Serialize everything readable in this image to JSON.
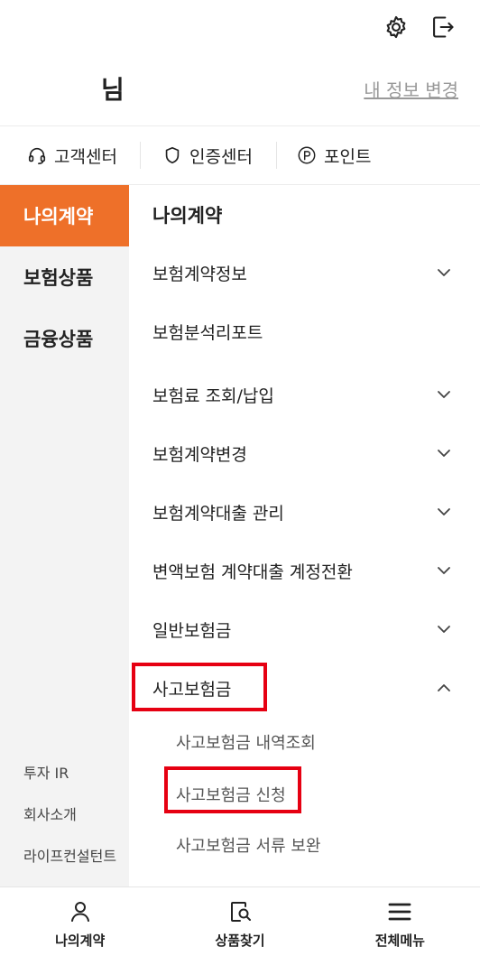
{
  "header": {
    "greeting_suffix": "님",
    "profile_link": "내 정보 변경"
  },
  "quick_links": [
    {
      "label": "고객센터",
      "icon": "headset-icon"
    },
    {
      "label": "인증센터",
      "icon": "shield-icon"
    },
    {
      "label": "포인트",
      "icon": "point-icon"
    }
  ],
  "sidebar": {
    "items": [
      {
        "label": "나의계약",
        "active": true
      },
      {
        "label": "보험상품",
        "active": false
      },
      {
        "label": "금융상품",
        "active": false
      }
    ],
    "footer_links": [
      "투자 IR",
      "회사소개",
      "라이프컨설턴트"
    ]
  },
  "content": {
    "section_title": "나의계약",
    "menu": [
      {
        "label": "보험계약정보",
        "chevron": "down"
      },
      {
        "label": "보험분석리포트",
        "chevron": "none"
      },
      {
        "label": "보험료 조회/납입",
        "chevron": "down"
      },
      {
        "label": "보험계약변경",
        "chevron": "down"
      },
      {
        "label": "보험계약대출 관리",
        "chevron": "down"
      },
      {
        "label": "변액보험 계약대출 계정전환",
        "chevron": "down"
      },
      {
        "label": "일반보험금",
        "chevron": "down"
      },
      {
        "label": "사고보험금",
        "chevron": "up"
      }
    ],
    "submenu": [
      "사고보험금 내역조회",
      "사고보험금 신청",
      "사고보험금 서류 보완"
    ]
  },
  "bottom_nav": [
    {
      "label": "나의계약",
      "icon": "person-icon"
    },
    {
      "label": "상품찾기",
      "icon": "product-search-icon"
    },
    {
      "label": "전체메뉴",
      "icon": "hamburger-icon"
    }
  ],
  "colors": {
    "accent": "#ee7029",
    "highlight": "#e60012"
  }
}
